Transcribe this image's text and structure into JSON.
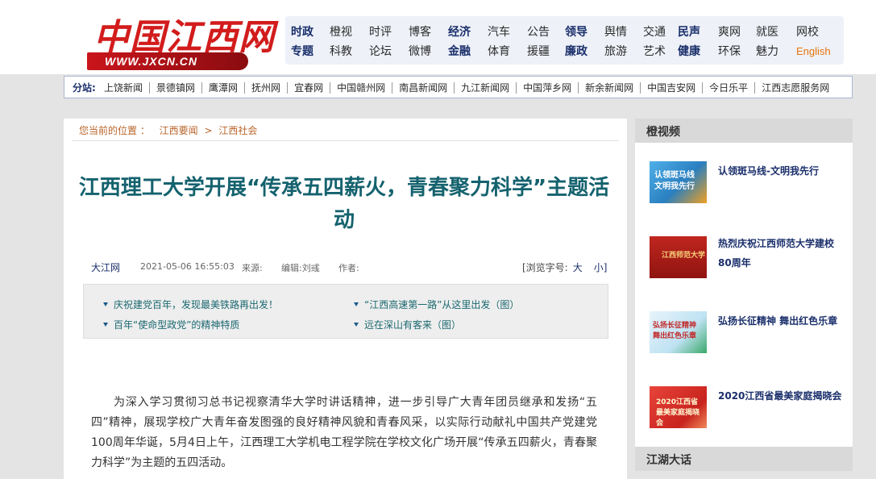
{
  "logo": {
    "chinese": "中国江西网",
    "url": "WWW.JXCN.CN"
  },
  "topnav": {
    "row1": [
      "时政",
      "橙视",
      "时评",
      "博客",
      "经济",
      "汽车",
      "公告",
      "领导",
      "舆情",
      "交通",
      "民声",
      "爽网",
      "就医",
      "网校"
    ],
    "row2": [
      "专题",
      "科教",
      "论坛",
      "微博",
      "金融",
      "体育",
      "援疆",
      "廉政",
      "旅游",
      "艺术",
      "健康",
      "环保",
      "魅力",
      "English"
    ]
  },
  "sites": {
    "label": "分站:",
    "items": [
      "上饶新闻",
      "景德镇网",
      "鹰潭网",
      "抚州网",
      "宜春网",
      "中国赣州网",
      "南昌新闻网",
      "九江新闻网",
      "中国萍乡网",
      "新余新闻网",
      "中国吉安网",
      "今日乐平",
      "江西志愿服务网"
    ]
  },
  "breadcrumb": {
    "prefix": "您当前的位置 ：",
    "items": [
      "江西要闻",
      "江西社会"
    ],
    "sep": ">"
  },
  "article": {
    "title": "江西理工大学开展“传承五四薪火，青春聚力科学”主题活动",
    "source": "大江网",
    "date": "2021-05-06 16:55:03",
    "from_label": "来源:",
    "editor_label": "编辑:刘彧",
    "author_label": "作者:",
    "fontsize_label": "[浏览字号:",
    "fontsize_large": "大",
    "fontsize_small": "小]",
    "body": "为深入学习贯彻习总书记视察清华大学时讲话精神，进一步引导广大青年团员继承和发扬“五四”精神，展现学校广大青年奋发图强的良好精神风貌和青春风采，以实际行动献礼中国共产党建党100周年华诞，5月4日上午，江西理工大学机电工程学院在学校文化广场开展“传承五四薪火，青春聚力科学”为主题的五四活动。"
  },
  "related": [
    "庆祝建党百年，发现最美铁路再出发！",
    "“江西高速第一路”从这里出发（图）",
    "百年“使命型政党”的精神特质",
    "远在深山有客来（图）"
  ],
  "sidebar": {
    "section1": "橙视频",
    "section2": "江湖大话",
    "items": [
      {
        "title": "认领斑马线-文明我先行",
        "thumb_text": "认领斑马线 文明我先行",
        "color": "#3a9ad9"
      },
      {
        "title": "热烈庆祝江西师范大学建校80周年",
        "thumb_text": "江西师范大学",
        "color": "#b8201c"
      },
      {
        "title": "弘扬长征精神  舞出红色乐章",
        "thumb_text": "弘扬长征精神 舞出红色乐章",
        "color": "#2f9ad0"
      },
      {
        "title": "2020江西省最美家庭揭晓会",
        "thumb_text": "2020江西省最美家庭揭晓会",
        "color": "#d8302a"
      }
    ]
  }
}
